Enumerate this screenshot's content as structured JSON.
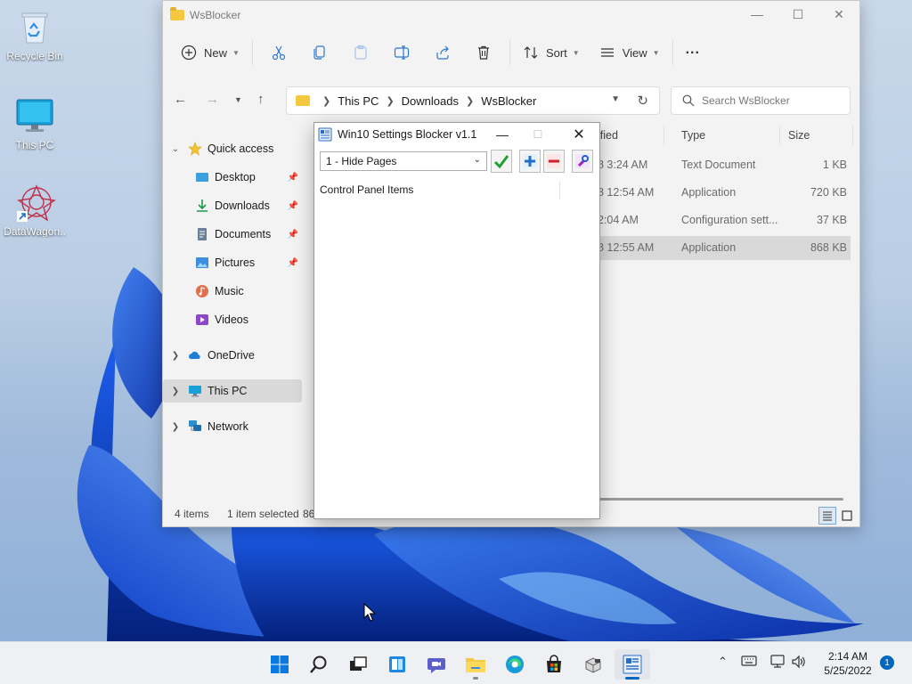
{
  "desktop": {
    "icons": [
      {
        "label": "Recycle Bin",
        "icon": "recycle-bin-icon"
      },
      {
        "label": "This PC",
        "icon": "monitor-icon"
      },
      {
        "label": "DataWagon..",
        "icon": "datawagon-icon"
      }
    ]
  },
  "explorer": {
    "title": "WsBlocker",
    "toolbar": {
      "new_label": "New",
      "sort_label": "Sort",
      "view_label": "View",
      "more_label": "..."
    },
    "address": {
      "segments": [
        "This PC",
        "Downloads",
        "WsBlocker"
      ]
    },
    "search": {
      "placeholder": "Search WsBlocker"
    },
    "sidebar": {
      "quick_access": "Quick access",
      "items": [
        {
          "label": "Desktop",
          "icon": "desktop-icon",
          "pinned": true
        },
        {
          "label": "Downloads",
          "icon": "download-icon",
          "pinned": true
        },
        {
          "label": "Documents",
          "icon": "document-icon",
          "pinned": true
        },
        {
          "label": "Pictures",
          "icon": "pictures-icon",
          "pinned": true
        },
        {
          "label": "Music",
          "icon": "music-icon",
          "pinned": false
        },
        {
          "label": "Videos",
          "icon": "videos-icon",
          "pinned": false
        }
      ],
      "onedrive": "OneDrive",
      "this_pc": "This PC",
      "network": "Network"
    },
    "columns": {
      "modified": "ified",
      "type": "Type",
      "size": "Size"
    },
    "files": [
      {
        "modified": "8 3:24 AM",
        "type": "Text Document",
        "size": "1 KB",
        "selected": false
      },
      {
        "modified": "8 12:54 AM",
        "type": "Application",
        "size": "720 KB",
        "selected": false
      },
      {
        "modified": "2:04 AM",
        "type": "Configuration sett...",
        "size": "37 KB",
        "selected": false
      },
      {
        "modified": "8 12:55 AM",
        "type": "Application",
        "size": "868 KB",
        "selected": true
      }
    ],
    "status": {
      "count": "4 items",
      "selected": "1 item selected",
      "size": "86"
    }
  },
  "blocker": {
    "title": "Win10 Settings Blocker v1.1",
    "mode": "1 - Hide Pages",
    "list_header": "Control Panel Items"
  },
  "taskbar": {
    "time": "2:14 AM",
    "date": "5/25/2022",
    "notifications": "1"
  },
  "colors": {
    "accent": "#0067c0",
    "selection": "#d9d9d9",
    "wallpaper_blue": "#1c5fe0"
  }
}
